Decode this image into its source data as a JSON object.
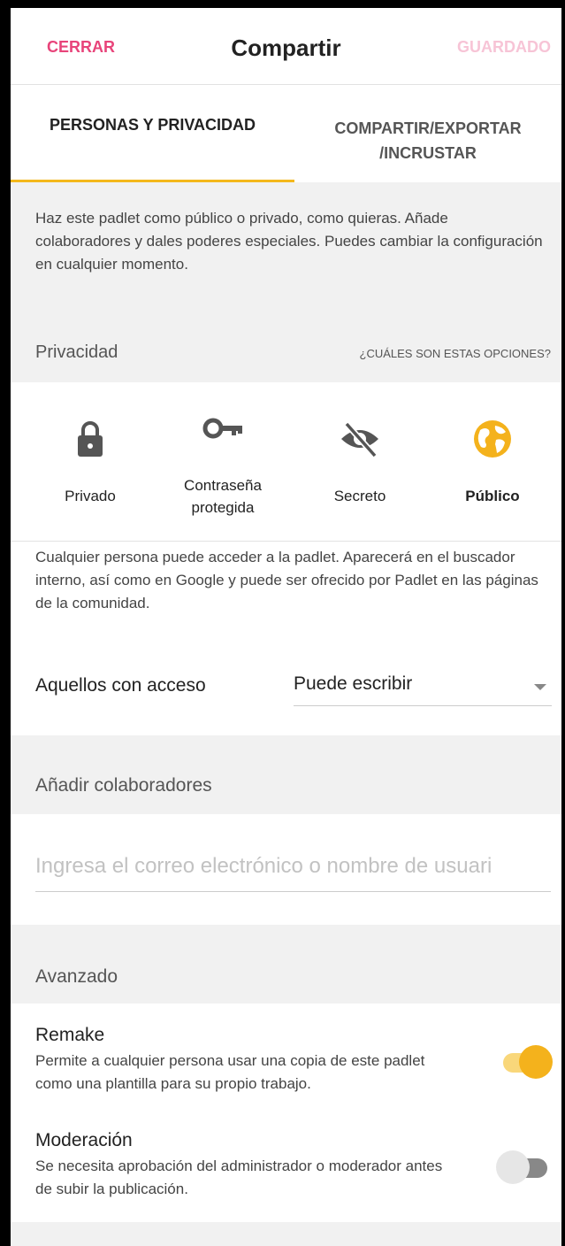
{
  "header": {
    "close_label": "CERRAR",
    "title": "Compartir",
    "saved_label": "GUARDADO"
  },
  "tabs": {
    "people_privacy": "PERSONAS Y PRIVACIDAD",
    "share_export_line1": "COMPARTIR/EXPORTAR",
    "share_export_line2": "/INCRUSTAR"
  },
  "intro": {
    "text": "Haz este padlet como público o privado, como quieras. Añade colaboradores y dales poderes especiales. Puedes cambiar la configuración en cualquier momento."
  },
  "privacy": {
    "label": "Privacidad",
    "help_link": "¿CUÁLES SON ESTAS OPCIONES?",
    "options": [
      {
        "label": "Privado",
        "icon": "lock-icon"
      },
      {
        "label_line1": "Contraseña",
        "label_line2": "protegida",
        "icon": "key-icon"
      },
      {
        "label": "Secreto",
        "icon": "eye-slash-icon"
      },
      {
        "label": "Público",
        "icon": "globe-icon",
        "selected": true
      }
    ],
    "description": "Cualquier persona puede acceder a la padlet. Aparecerá en el buscador interno, así como en Google y puede ser ofrecido por Padlet en las páginas de la comunidad."
  },
  "access": {
    "label": "Aquellos con acceso",
    "value": "Puede escribir"
  },
  "collaborators": {
    "title": "Añadir colaboradores",
    "placeholder": "Ingresa el correo electrónico o nombre de usuari"
  },
  "advanced": {
    "title": "Avanzado",
    "remake": {
      "title": "Remake",
      "description": "Permite a cualquier persona usar una copia de este padlet como una plantilla para su propio trabajo.",
      "enabled": true
    },
    "moderation": {
      "title": "Moderación",
      "description": "Se necesita aprobación del administrador o moderador antes de subir la publicación.",
      "enabled": false
    }
  },
  "colors": {
    "accent_pink": "#e8447a",
    "accent_yellow": "#f4b21c"
  }
}
